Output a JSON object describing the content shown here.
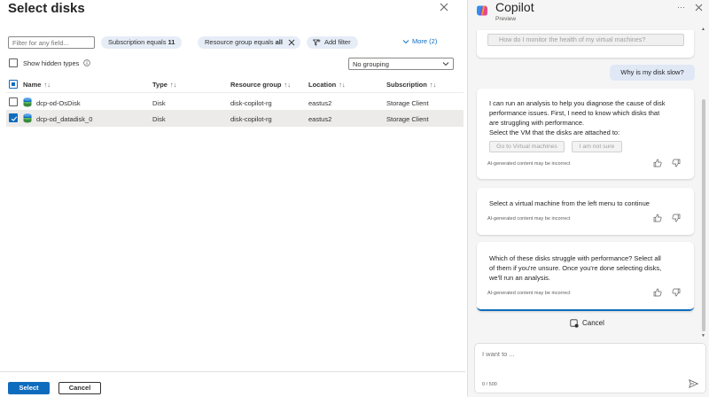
{
  "left": {
    "title": "Select disks",
    "filter_placeholder": "Filter for any field...",
    "pills": [
      {
        "prefix": "Subscription equals ",
        "value": "11"
      },
      {
        "prefix": "Resource group equals ",
        "value": "all"
      }
    ],
    "add_filter": "Add filter",
    "more": "More (2)",
    "show_hidden": "Show hidden types",
    "grouping": "No grouping",
    "columns": [
      "Name",
      "Type",
      "Resource group",
      "Location",
      "Subscription"
    ],
    "sort_glyph": "↑↓",
    "rows": [
      {
        "name": "dcp-od-OsDisk",
        "type": "Disk",
        "group": "disk-copilot-rg",
        "location": "eastus2",
        "subscription": "Storage Client",
        "checked": false
      },
      {
        "name": "dcp-od_datadisk_0",
        "type": "Disk",
        "group": "disk-copilot-rg",
        "location": "eastus2",
        "subscription": "Storage Client",
        "checked": true
      }
    ],
    "select_button": "Select",
    "cancel_button": "Cancel"
  },
  "copilot": {
    "title": "Copilot",
    "subtitle": "Preview",
    "more": "···",
    "suggestion": "How do I monitor the health of my virtual machines?",
    "user_message": "Why is my disk slow?",
    "messages": [
      {
        "text_lines": [
          "I can run an analysis to help you diagnose the cause of disk",
          "performance issues. First, I need to know which disks that",
          "are struggling with performance.",
          "Select the VM that the disks are attached to:"
        ],
        "buttons": [
          "Go to Virtual machines",
          "I am not sure"
        ],
        "note": "AI-generated content may be incorrect"
      },
      {
        "text_lines": [
          "Select a virtual machine from the left menu to continue"
        ],
        "note": "AI-generated content may be incorrect"
      },
      {
        "text_lines": [
          "Which of these disks struggle with performance? Select all",
          "of them if you're unsure. Once you're done selecting disks,",
          "we'll run an analysis."
        ],
        "note": "AI-generated content may be incorrect"
      }
    ],
    "cancel": "Cancel",
    "compose_placeholder": "I want to ...",
    "counter": "0 / 500"
  },
  "colors": {
    "accent": "#0f6cbd",
    "pill_bg": "#e6edf7",
    "panel_bg": "#f5f5f5",
    "user_bubble": "#e0e8f6"
  }
}
